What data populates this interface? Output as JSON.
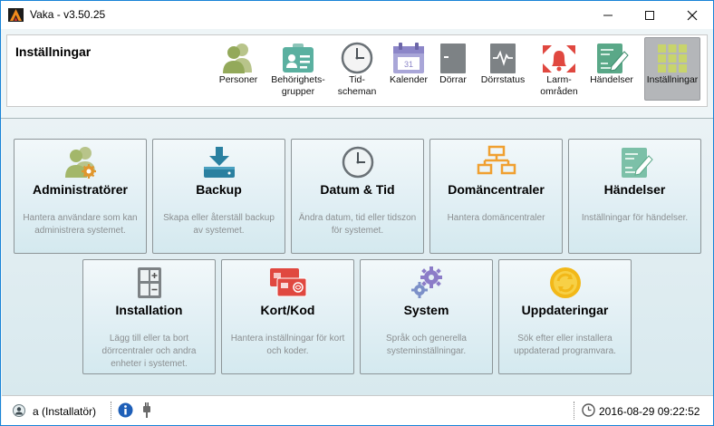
{
  "window": {
    "title": "Vaka - v3.50.25"
  },
  "toolbar": {
    "title": "Inställningar",
    "items": [
      {
        "label": "Personer",
        "icon": "people-icon"
      },
      {
        "label": "Behörighets-\ngrupper",
        "icon": "badge-icon"
      },
      {
        "label": "Tid-\nscheman",
        "icon": "clock-icon"
      },
      {
        "label": "Kalender",
        "icon": "calendar-icon"
      },
      {
        "label": "Dörrar",
        "icon": "door-icon"
      },
      {
        "label": "Dörrstatus",
        "icon": "door-status-icon"
      },
      {
        "label": "Larm-\nområden",
        "icon": "alarm-area-icon"
      },
      {
        "label": "Händelser",
        "icon": "events-icon"
      },
      {
        "label": "Inställningar",
        "icon": "settings-grid-icon",
        "active": true
      }
    ]
  },
  "cards": [
    {
      "title": "Administratörer",
      "desc": "Hantera användare som kan administrera systemet.",
      "icon": "admin-users-icon"
    },
    {
      "title": "Backup",
      "desc": "Skapa eller återställ backup av systemet.",
      "icon": "backup-download-icon"
    },
    {
      "title": "Datum & Tid",
      "desc": "Ändra datum, tid eller tidszon för systemet.",
      "icon": "clock-icon"
    },
    {
      "title": "Domäncentraler",
      "desc": "Hantera domäncentraler",
      "icon": "hierarchy-icon"
    },
    {
      "title": "Händelser",
      "desc": "Inställningar för händelser.",
      "icon": "events-icon"
    },
    {
      "title": "Installation",
      "desc": "Lägg till eller ta bort dörrcentraler och andra enheter i systemet.",
      "icon": "installation-panel-icon"
    },
    {
      "title": "Kort/Kod",
      "desc": "Hantera inställningar för kort och koder.",
      "icon": "card-icon"
    },
    {
      "title": "System",
      "desc": "Språk och generella systeminställningar.",
      "icon": "gears-icon"
    },
    {
      "title": "Uppdateringar",
      "desc": "Sök efter eller installera uppdaterad programvara.",
      "icon": "update-icon"
    }
  ],
  "status": {
    "user": "a (Installatör)",
    "datetime": "2016-08-29 09:22:52"
  },
  "colors": {
    "accent_green": "#a8c060",
    "accent_orange": "#f0a030",
    "accent_red": "#e04840",
    "accent_teal": "#2a80a0",
    "accent_purple": "#8c7cc8"
  }
}
